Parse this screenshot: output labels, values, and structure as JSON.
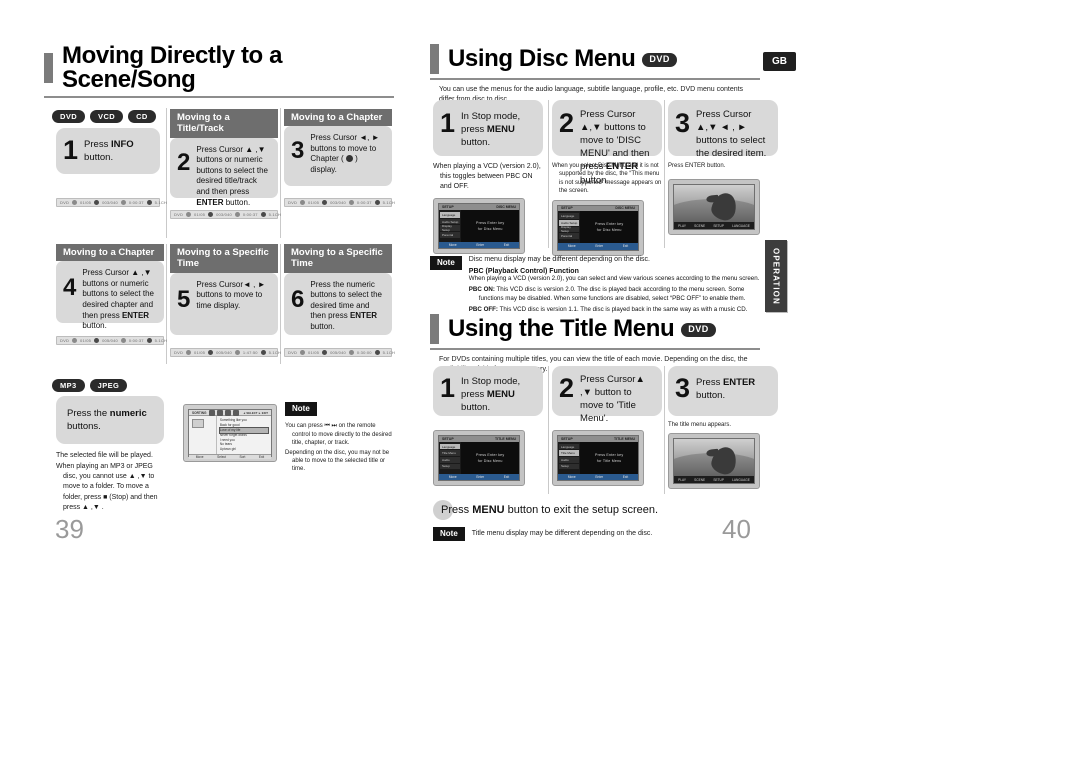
{
  "document": {
    "language_badge": "GB",
    "side_tab": "OPERATION",
    "left_page_number": "39",
    "right_page_number": "40"
  },
  "left_page": {
    "title": "Moving Directly to a Scene/Song",
    "disc_pills": [
      "DVD",
      "VCD",
      "CD"
    ],
    "steps": [
      {
        "caption": "",
        "number": "1",
        "text_html": "Press <b>INFO</b> button.",
        "osd_labels": [
          "DVD",
          "01/05",
          "003/040",
          "0:00:37",
          "ENG 5.1CH"
        ]
      },
      {
        "caption": "Moving to a Title/Track",
        "number": "2",
        "text_html": "Press Cursor ▲ ,▼ buttons or numeric buttons to select the desired title/track and then press <b>ENTER</b> button.",
        "osd_labels": [
          "DVD",
          "01/05",
          "003/040",
          "0:00:37",
          "ENG 5.1CH"
        ]
      },
      {
        "caption": "Moving to a Chapter",
        "number": "3",
        "text_html": "Press Cursor ◄, ► buttons to move to Chapter ( ● ) display.",
        "osd_labels": [
          "DVD",
          "01/05",
          "003/040",
          "0:00:37",
          "ENG 5.1CH"
        ]
      },
      {
        "caption": "Moving to a Chapter",
        "number": "4",
        "text_html": "Press Cursor ▲ ,▼ buttons or numeric buttons to select the desired chapter and then press <b>ENTER</b> button.",
        "osd_labels": [
          "DVD",
          "01/05",
          "005/040",
          "0:00:37",
          "ENG 5.1CH"
        ]
      },
      {
        "caption": "Moving to a Specific Time",
        "number": "5",
        "text_html": "Press Cursor ◄ , ► buttons to move to time display.",
        "osd_labels": [
          "DVD",
          "01/05",
          "005/040",
          "1:47:50",
          "ENG 5.1CH"
        ]
      },
      {
        "caption": "Moving to a Specific Time",
        "number": "6",
        "text_html": "Press the numeric buttons to select the desired time and then press <b>ENTER</b> button.",
        "osd_labels": [
          "DVD",
          "01/05",
          "005/040",
          "0:30:00",
          "ENG 5.1CH"
        ]
      }
    ],
    "mp3_section": {
      "pills": [
        "MP3",
        "JPEG"
      ],
      "instruction_html": "Press the <b>numeric</b> buttons.",
      "bullets": [
        "The selected file will be played.",
        "When playing an MP3 or JPEG disc, you cannot use ▲ ,▼ to move to a folder. To move a folder, press ■ (Stop) and then press ▲ ,▼ ."
      ],
      "screen": {
        "header_label": "SORTING",
        "header_right": "◄ SELECT  ► EXIT",
        "folder_label": "Root",
        "tracks": [
          "Something like you",
          "Back for good",
          "Love of my life",
          "Never forget words",
          "I need you",
          "No tears",
          "Uptown girl"
        ],
        "selected_index": 2,
        "footer": [
          "Move",
          "Select",
          "Sort",
          "Exit"
        ]
      },
      "note": {
        "badge": "Note",
        "bullets": [
          "You can press ⏮ ⏭ on the remote control to move directly to the desired title, chapter, or track.",
          "Depending on the disc, you may not be able to move to the selected title or time."
        ]
      }
    }
  },
  "right_page": {
    "disc_menu": {
      "title": "Using Disc Menu",
      "disc_badge": "DVD",
      "intro": "You can use the menus for the audio language, subtitle language, profile, etc. DVD menu contents differ from disc to disc.",
      "steps": [
        {
          "number": "1",
          "text_html": "In Stop mode, press <b>MENU</b> button.",
          "bullets": [
            "When playing a VCD (version 2.0), this toggles between PBC ON and OFF."
          ],
          "screen_type": "disc-menu"
        },
        {
          "number": "2",
          "text_html": "Press Cursor ▲,▼ buttons to move to 'DISC MENU' and then press <b>ENTER</b> button.",
          "bullets": [
            "When you select Disc Menu and it is not supported by the disc, the “This menu is not supported” message appears on the screen."
          ],
          "screen_type": "disc-menu-2"
        },
        {
          "number": "3",
          "text_html": "Press Cursor ▲,▼ ◄ , ► buttons to select the desired item.",
          "bullets": [
            "Press ENTER button."
          ],
          "screen_type": "photo"
        }
      ],
      "note": {
        "badge": "Note",
        "bullet": "Disc menu display may be different depending on the disc.",
        "pbc_title": "PBC (Playback Control) Function",
        "pbc_intro": "When playing a VCD (version 2.0), you can select and view various scenes according to the menu screen.",
        "pbc_on_label": "PBC ON:",
        "pbc_on_text": "This VCD disc is version 2.0. The disc is played back according to the menu screen. Some functions may be disabled. When some functions are disabled, select “PBC OFF” to enable them.",
        "pbc_off_label": "PBC OFF:",
        "pbc_off_text": "This VCD disc is version 1.1. The disc is played back in the same way as with a music CD."
      }
    },
    "title_menu": {
      "title": "Using the Title Menu",
      "disc_badge": "DVD",
      "intro": "For DVDs containing multiple titles, you can view the title of each movie. Depending on the disc, the availability of this feature may vary.",
      "steps": [
        {
          "number": "1",
          "text_html": "In Stop mode, press <b>MENU</b> button.",
          "bullets": [],
          "screen_type": "disc-menu"
        },
        {
          "number": "2",
          "text_html": "Press Cursor ▲ ,▼ button to move to 'Title Menu'.",
          "bullets": [],
          "screen_type": "title-menu"
        },
        {
          "number": "3",
          "text_html": "Press <b>ENTER</b> button.",
          "bullets": [
            "The title menu appears."
          ],
          "screen_type": "photo"
        }
      ],
      "exit_text_html": "Press <b>MENU</b> button to exit the setup screen.",
      "note": {
        "badge": "Note",
        "bullet": "Title menu display may be different depending on the disc."
      }
    },
    "screens": {
      "disc_menu": {
        "top_left": "SETUP",
        "top_right": "DISC MENU",
        "side_items": [
          "Language",
          "Audio Setup",
          "Display Setup",
          "Parental"
        ],
        "selected": 0,
        "main_lines": [
          "Press Enter key",
          "for Disc Menu"
        ],
        "footer": [
          "Move",
          "Enter",
          "Exit"
        ]
      },
      "title_menu": {
        "top_left": "SETUP",
        "top_right": "TITLE MENU",
        "side_items": [
          "Language",
          "Title Menu",
          "Audio",
          "Setup"
        ],
        "selected": 1,
        "main_lines": [
          "Press Enter key",
          "for Title Menu"
        ],
        "footer": [
          "Move",
          "Enter",
          "Exit"
        ]
      },
      "photo": {
        "footer": [
          "PLAY",
          "SCENE",
          "SETUP",
          "LANGUAGE"
        ]
      }
    }
  }
}
